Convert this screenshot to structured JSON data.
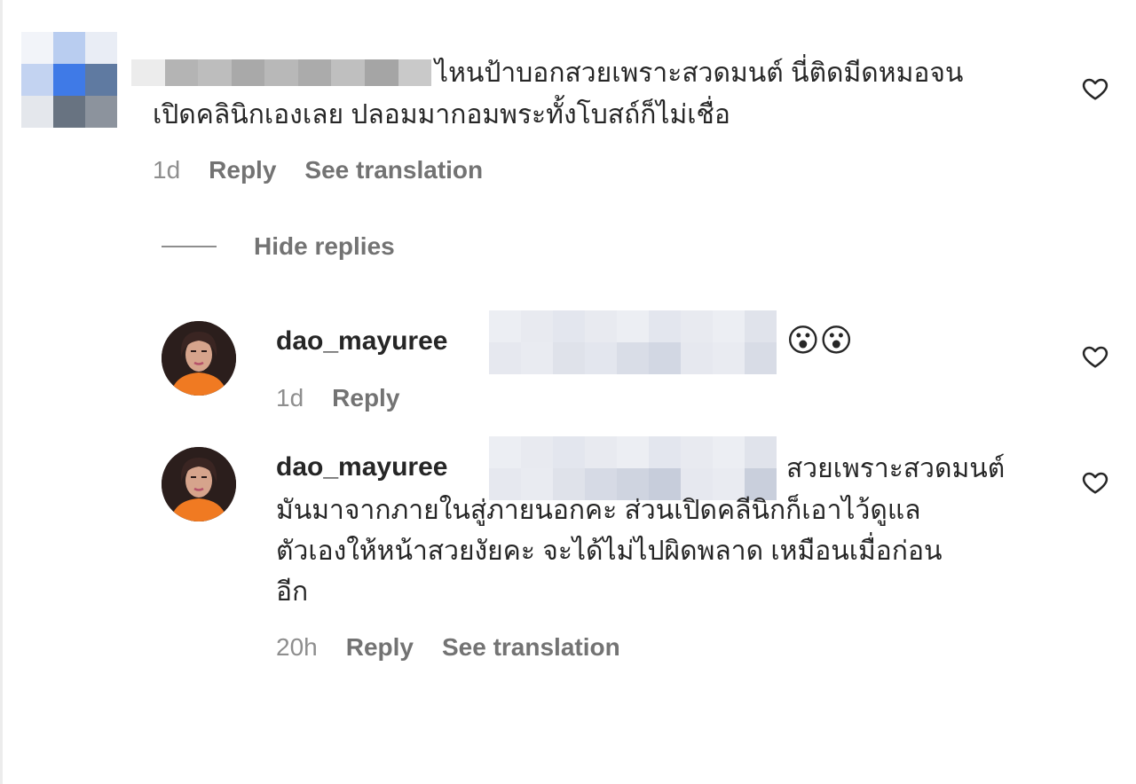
{
  "comment": {
    "text_line1": "ไหนป้าบอกสวยเพราะสวดมนต์ นี่ติดมีดหมอจน",
    "text_line2": "เปิดคลินิกเองเลย ปลอมมากอมพระทั้งโบสถ์ก็ไม่เชื่อ",
    "time": "1d",
    "reply_label": "Reply",
    "translate_label": "See translation",
    "avatar_icon": "pixelated-avatar-icon"
  },
  "thread": {
    "hide_replies_label": "Hide replies"
  },
  "replies": [
    {
      "username": "dao_mayuree",
      "text": "😮😮",
      "time": "1d",
      "reply_label": "Reply"
    },
    {
      "username": "dao_mayuree",
      "text_line1": "สวยเพราะสวดมนต์",
      "text_line2": "มันมาจากภายในสู่ภายนอกคะ ส่วนเปิดคลีนิกก็เอาไว้ดูแล",
      "text_line3": "ตัวเองให้หน้าสวยงัยคะ จะได้ไม่ไปผิดพลาด เหมือนเมื่อก่อน",
      "text_line4": "อีก",
      "time": "20h",
      "reply_label": "Reply",
      "translate_label": "See translation"
    }
  ],
  "icons": {
    "like": "heart-outline-icon"
  },
  "colors": {
    "text": "#262626",
    "secondary": "#737373",
    "timestamp": "#8e8e8e",
    "orange_top": "#f07a22"
  }
}
